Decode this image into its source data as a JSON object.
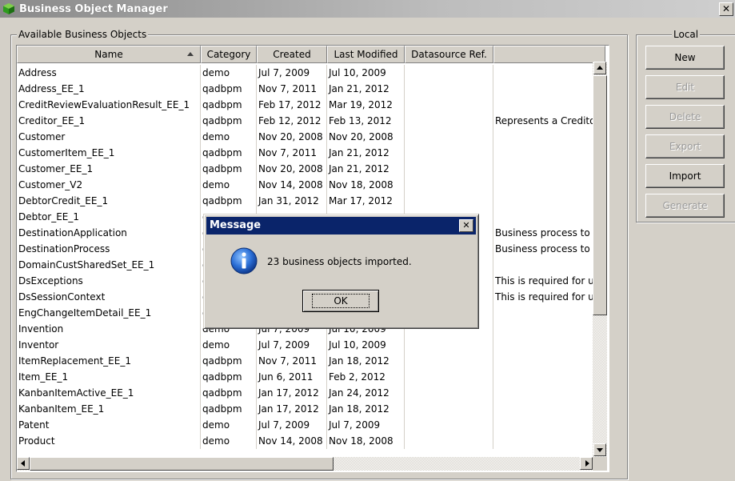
{
  "window": {
    "title": "Business Object Manager",
    "close_glyph": "✕",
    "icon": "app-cube-icon"
  },
  "groups": {
    "available": "Available Business Objects",
    "local": "Local"
  },
  "table": {
    "columns": [
      "Name",
      "Category",
      "Created",
      "Last Modified",
      "Datasource Ref.",
      ""
    ],
    "rows": [
      [
        "Address",
        "demo",
        "Jul 7, 2009",
        "Jul 10, 2009",
        "",
        ""
      ],
      [
        "Address_EE_1",
        "qadbpm",
        "Nov 7, 2011",
        "Jan 21, 2012",
        "",
        ""
      ],
      [
        "CreditReviewEvaluationResult_EE_1",
        "qadbpm",
        "Feb 17, 2012",
        "Mar 19, 2012",
        "",
        ""
      ],
      [
        "Creditor_EE_1",
        "qadbpm",
        "Feb 12, 2012",
        "Feb 13, 2012",
        "",
        "Represents a Creditor"
      ],
      [
        "Customer",
        "demo",
        "Nov 20, 2008",
        "Nov 20, 2008",
        "",
        ""
      ],
      [
        "CustomerItem_EE_1",
        "qadbpm",
        "Nov 7, 2011",
        "Jan 21, 2012",
        "",
        ""
      ],
      [
        "Customer_EE_1",
        "qadbpm",
        "Nov 20, 2008",
        "Jan 21, 2012",
        "",
        ""
      ],
      [
        "Customer_V2",
        "demo",
        "Nov 14, 2008",
        "Nov 18, 2008",
        "",
        ""
      ],
      [
        "DebtorCredit_EE_1",
        "qadbpm",
        "Jan 31, 2012",
        "Mar 17, 2012",
        "",
        ""
      ],
      [
        "Debtor_EE_1",
        "q",
        "",
        "",
        "",
        ""
      ],
      [
        "DestinationApplication",
        "q",
        "",
        "",
        "",
        "Business process to wl"
      ],
      [
        "DestinationProcess",
        "q",
        "",
        "",
        "",
        "Business process to wl"
      ],
      [
        "DomainCustSharedSet_EE_1",
        "q",
        "",
        "",
        "",
        ""
      ],
      [
        "DsExceptions",
        "q",
        "",
        "",
        "",
        "This is required for use"
      ],
      [
        "DsSessionContext",
        "q",
        "",
        "",
        "",
        "This is required for use"
      ],
      [
        "EngChangeItemDetail_EE_1",
        "q",
        "",
        "",
        "",
        ""
      ],
      [
        "Invention",
        "demo",
        "Jul 7, 2009",
        "Jul 10, 2009",
        "",
        ""
      ],
      [
        "Inventor",
        "demo",
        "Jul 7, 2009",
        "Jul 10, 2009",
        "",
        ""
      ],
      [
        "ItemReplacement_EE_1",
        "qadbpm",
        "Nov 7, 2011",
        "Jan 18, 2012",
        "",
        ""
      ],
      [
        "Item_EE_1",
        "qadbpm",
        "Jun 6, 2011",
        "Feb 2, 2012",
        "",
        ""
      ],
      [
        "KanbanItemActive_EE_1",
        "qadbpm",
        "Jan 17, 2012",
        "Jan 24, 2012",
        "",
        ""
      ],
      [
        "KanbanItem_EE_1",
        "qadbpm",
        "Jan 17, 2012",
        "Jan 18, 2012",
        "",
        ""
      ],
      [
        "Patent",
        "demo",
        "Jul 7, 2009",
        "Jul 7, 2009",
        "",
        ""
      ],
      [
        "Product",
        "demo",
        "Nov 14, 2008",
        "Nov 18, 2008",
        "",
        ""
      ]
    ]
  },
  "buttons": {
    "new": "New",
    "edit": "Edit",
    "delete": "Delete",
    "export": "Export",
    "import": "Import",
    "generate": "Generate"
  },
  "dialog": {
    "title": "Message",
    "message": "23 business objects imported.",
    "ok": "OK",
    "close_glyph": "✕",
    "icon": "info-icon"
  }
}
